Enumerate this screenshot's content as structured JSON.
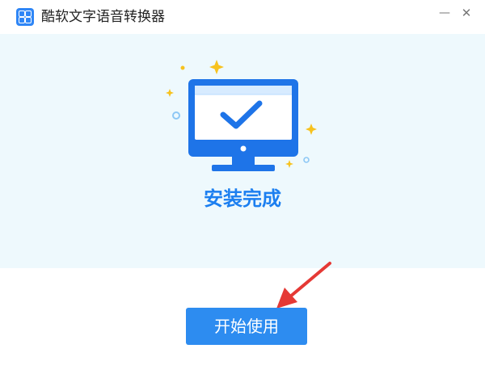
{
  "app": {
    "title": "酷软文字语音转换器",
    "icon": "app-logo-icon",
    "accent_color": "#2d8cf0"
  },
  "window_controls": {
    "minimize_icon": "minimize-icon",
    "minimize_glyph": "—",
    "close_icon": "close-icon",
    "close_glyph": "✕"
  },
  "hero": {
    "background": "#eef9fd",
    "illustration_icon": "monitor-checkmark-icon",
    "status_text": "安装完成"
  },
  "actions": {
    "start_label": "开始使用"
  },
  "annotation": {
    "arrow_icon": "red-arrow-icon",
    "color": "#e53935"
  }
}
